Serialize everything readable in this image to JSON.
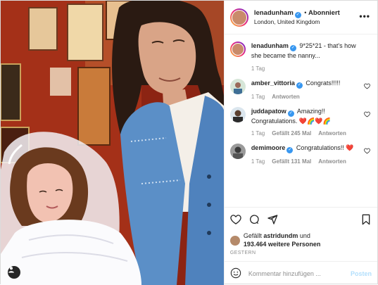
{
  "post": {
    "author": "lenadunham",
    "follow_label": "Abonniert",
    "location": "London, United Kingdom",
    "more_label": "•••",
    "caption_user": "lenadunham",
    "caption_text": "9*25*21 - that's how she became the nanny...",
    "caption_time": "1 Tag"
  },
  "comments": [
    {
      "user": "amber_vittoria",
      "text": "Congrats!!!!!",
      "time": "1 Tag",
      "likes": "",
      "reply": "Antworten"
    },
    {
      "user": "juddapatow",
      "text": "Amazing!! Congratulations. ❤️🌈❤️🌈",
      "time": "1 Tag",
      "likes": "Gefällt 245 Mal",
      "reply": "Antworten"
    },
    {
      "user": "demimoore",
      "text": "Congratulations!! ❤️",
      "time": "1 Tag",
      "likes": "Gefällt 131 Mal",
      "reply": "Antworten"
    }
  ],
  "likes": {
    "prefix": "Gefällt",
    "user": "astridundm",
    "and": "und",
    "count": "193.464 weitere Personen"
  },
  "date_label": "GESTERN",
  "composer": {
    "placeholder": "Kommentar hinzufügen ...",
    "post_label": "Posten"
  },
  "icons": {
    "like": "heart-icon",
    "comment": "comment-icon",
    "share": "share-icon",
    "save": "bookmark-icon",
    "emoji": "emoji-icon",
    "tag": "user-tag-icon"
  },
  "colors": {
    "verified": "#3897f0",
    "post_button": "#b2dffc",
    "secondary_text": "#8e8e8e"
  }
}
